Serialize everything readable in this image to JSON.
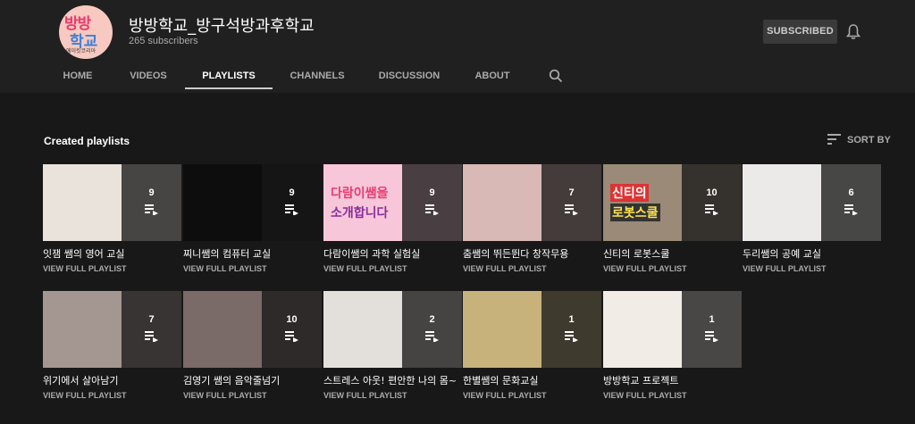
{
  "channel": {
    "name": "방방학교_방구석방과후학교",
    "subscribers": "265 subscribers",
    "avatar_line1": "방방",
    "avatar_line2": "학교",
    "avatar_line3": "에이킷코리아",
    "subscribe_label": "SUBSCRIBED"
  },
  "tabs": [
    {
      "label": "HOME"
    },
    {
      "label": "VIDEOS"
    },
    {
      "label": "PLAYLISTS"
    },
    {
      "label": "CHANNELS"
    },
    {
      "label": "DISCUSSION"
    },
    {
      "label": "ABOUT"
    }
  ],
  "section": {
    "title": "Created playlists",
    "sort_label": "SORT BY"
  },
  "view_full_label": "VIEW FULL PLAYLIST",
  "playlists": [
    {
      "title": "잇잼 쌤의 영어 교실",
      "count": "9",
      "thumb_color": "#e9e3dc"
    },
    {
      "title": "찌니쌤의 컴퓨터 교실",
      "count": "9",
      "thumb_color": "#0d0d0d"
    },
    {
      "title": "다람이쌤의 과학 실험실",
      "count": "9",
      "thumb_color": "#f7c7d9",
      "thumb_text_1": "다람이쌤을",
      "thumb_text_2": "소개합니다"
    },
    {
      "title": "춤쌤의 뛰든뛴다 창작무용",
      "count": "7",
      "thumb_color": "#d9b9b5"
    },
    {
      "title": "신티의 로봇스쿨",
      "count": "10",
      "thumb_color": "#9a8a77",
      "thumb_text_1": "신티의",
      "thumb_text_2": "로봇스쿨"
    },
    {
      "title": "두리쌤의 공예 교실",
      "count": "6",
      "thumb_color": "#eceae9"
    },
    {
      "title": "위기에서 살아남기",
      "count": "7",
      "thumb_color": "#a49690"
    },
    {
      "title": "김영기 쌤의 음악줄넘기",
      "count": "10",
      "thumb_color": "#7a6a68"
    },
    {
      "title": "스트레스 아웃! 편안한 나의 몸~",
      "count": "2",
      "thumb_color": "#e3e0dc"
    },
    {
      "title": "한별쌤의 문화교실",
      "count": "1",
      "thumb_color": "#c8b27b"
    },
    {
      "title": "방방학교 프로젝트",
      "count": "1",
      "thumb_color": "#f2ece6"
    }
  ]
}
